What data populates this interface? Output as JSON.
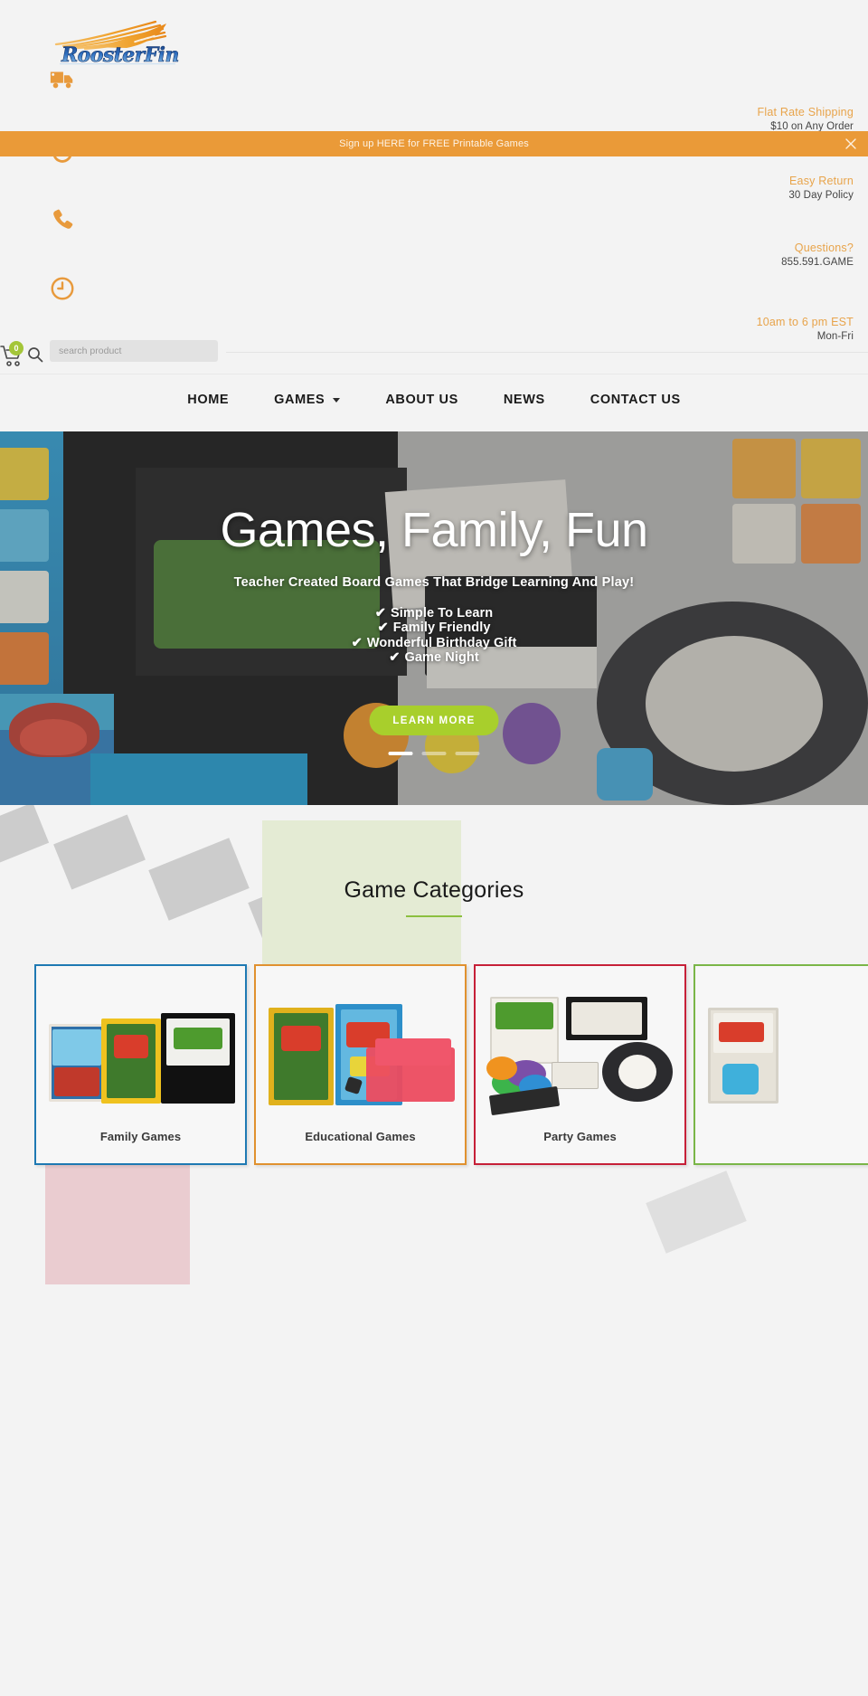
{
  "brand": {
    "name": "RoosterFin",
    "logo_alt": "RoosterFin"
  },
  "promo": {
    "text": "Sign up HERE for FREE Printable Games",
    "close_icon": "close-icon",
    "bg_color": "#ea9a38"
  },
  "info_blocks": [
    {
      "icon": "truck-icon",
      "title": "Flat Rate Shipping",
      "sub": "$10 on Any Order"
    },
    {
      "icon": "return-icon",
      "title": "Easy Return",
      "sub": "30 Day Policy"
    },
    {
      "icon": "phone-icon",
      "title": "Questions?",
      "sub": "855.591.GAME"
    },
    {
      "icon": "clock-icon",
      "title": "10am to 6 pm EST",
      "sub": "Mon-Fri"
    }
  ],
  "search": {
    "placeholder": "search product",
    "value": "",
    "icon": "search-icon"
  },
  "cart": {
    "icon": "cart-icon",
    "count": "0",
    "badge_color": "#a4c639"
  },
  "nav": {
    "items": [
      {
        "label": "HOME",
        "has_dropdown": false
      },
      {
        "label": "GAMES",
        "has_dropdown": true
      },
      {
        "label": "ABOUT US",
        "has_dropdown": false
      },
      {
        "label": "NEWS",
        "has_dropdown": false
      },
      {
        "label": "CONTACT US",
        "has_dropdown": false
      }
    ]
  },
  "hero": {
    "title": "Games, Family, Fun",
    "subtitle": "Teacher Created Board Games That Bridge Learning And Play!",
    "bullets": [
      "Simple To Learn",
      "Family Friendly",
      "Wonderful Birthday Gift",
      "Game Night"
    ],
    "tick": "✔",
    "cta_label": "LEARN MORE",
    "cta_color": "#a8cf2c",
    "slides": 3,
    "active_slide": 1
  },
  "categories": {
    "heading": "Game Categories",
    "accent_color": "#8cbf3f",
    "panel_color": "#e4ebd4",
    "cards": [
      {
        "label": "Family Games",
        "border_color": "#1e79b3"
      },
      {
        "label": "Educational Games",
        "border_color": "#e0912f"
      },
      {
        "label": "Party Games",
        "border_color": "#c62038"
      },
      {
        "label": "",
        "border_color": "#7ab648"
      }
    ]
  }
}
